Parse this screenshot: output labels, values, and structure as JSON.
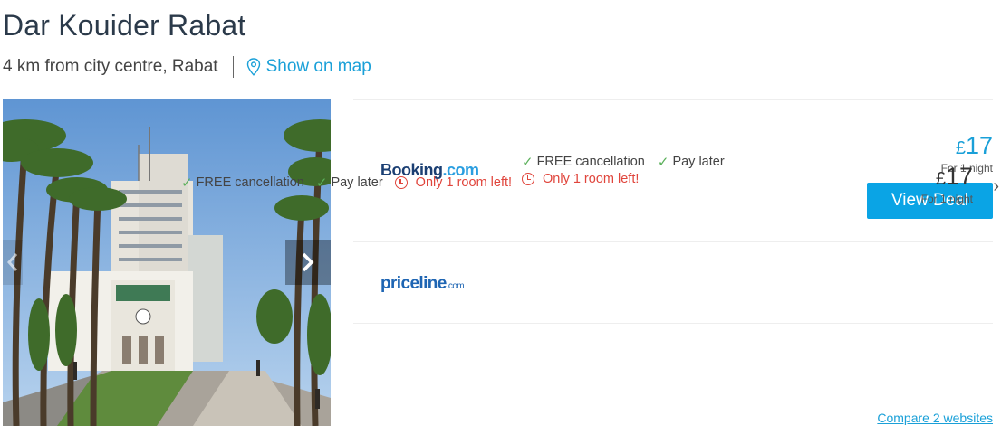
{
  "hotel": {
    "name": "Dar Kouider Rabat",
    "location": "4 km from city centre, Rabat",
    "map_link": "Show on map",
    "photo_icon": "hotel-photo"
  },
  "gallery": {
    "prev_icon": "chevron-left-icon",
    "next_icon": "chevron-right-icon",
    "next_glyph": "›"
  },
  "deals": [
    {
      "provider_part1": "Booking",
      "provider_part2": ".com",
      "features": [
        "FREE cancellation",
        "Pay later"
      ],
      "availability": "Only 1 room left!",
      "currency": "£",
      "price": "17",
      "per_night": "For 1 night",
      "cta": "View Deal"
    },
    {
      "provider_part1": "priceline",
      "provider_part2": ".com",
      "features": [
        "FREE cancellation",
        "Pay later"
      ],
      "availability": "Only 1 room left!",
      "currency": "£",
      "price": "17",
      "per_night": "For 1 night",
      "more_glyph": "›"
    }
  ],
  "compare_link": "Compare 2 websites",
  "colors": {
    "accent": "#0aa4e5",
    "link": "#1aa0d8",
    "warning": "#e0453c",
    "check": "#5bb05b",
    "title": "#2b3a4a"
  },
  "check_glyph": "✓"
}
